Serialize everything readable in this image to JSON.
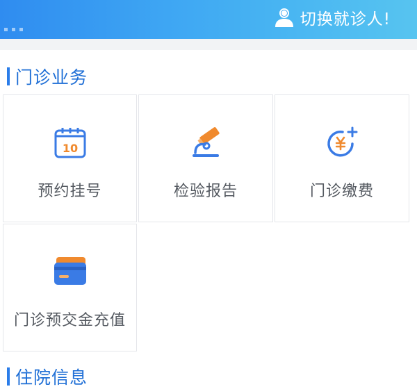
{
  "header": {
    "switch_patient_label": "切换就诊人!",
    "user_icon": "user-icon",
    "gradient_start": "#2f8cf0",
    "gradient_end": "#57c4f0"
  },
  "sections": {
    "outpatient": {
      "title": "门诊业务"
    },
    "inpatient": {
      "title": "住院信息"
    }
  },
  "outpatient_services": [
    {
      "label": "预约挂号",
      "icon": "calendar-icon"
    },
    {
      "label": "检验报告",
      "icon": "microscope-icon"
    },
    {
      "label": "门诊缴费",
      "icon": "yuan-payment-icon"
    },
    {
      "label": "门诊预交金充值",
      "icon": "card-icon"
    }
  ],
  "colors": {
    "accent_blue": "#2b7de9",
    "icon_orange": "#f08a2e",
    "icon_blue": "#3a7be5"
  }
}
